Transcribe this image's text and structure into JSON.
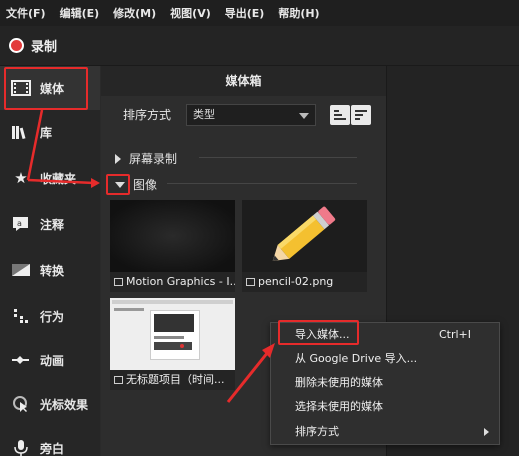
{
  "menubar": {
    "items": [
      "文件(F)",
      "编辑(E)",
      "修改(M)",
      "视图(V)",
      "导出(E)",
      "帮助(H)"
    ]
  },
  "record": {
    "label": "录制",
    "color": "#e33b3b"
  },
  "sidebar": {
    "items": [
      {
        "label": "媒体",
        "icon": "film-icon"
      },
      {
        "label": "库",
        "icon": "library-icon"
      },
      {
        "label": "收藏夹",
        "icon": "star-icon"
      },
      {
        "label": "注释",
        "icon": "annotation-icon"
      },
      {
        "label": "转换",
        "icon": "transition-icon"
      },
      {
        "label": "行为",
        "icon": "behavior-icon"
      },
      {
        "label": "动画",
        "icon": "animation-icon"
      },
      {
        "label": "光标效果",
        "icon": "cursor-icon"
      },
      {
        "label": "旁白",
        "icon": "microphone-icon"
      }
    ]
  },
  "panel": {
    "title": "媒体箱",
    "sort_label": "排序方式",
    "sort_value": "类型",
    "sections": {
      "screen_recording": "屏幕录制",
      "images": "图像"
    },
    "thumbs": [
      {
        "caption": "Motion Graphics - I..."
      },
      {
        "caption": "pencil-02.png"
      },
      {
        "caption": "无标题项目（时间..."
      }
    ]
  },
  "context_menu": {
    "items": [
      {
        "label": "导入媒体...",
        "shortcut": "Ctrl+I"
      },
      {
        "label": "从 Google Drive 导入..."
      },
      {
        "label": "删除未使用的媒体"
      },
      {
        "label": "选择未使用的媒体"
      },
      {
        "label": "排序方式"
      }
    ]
  },
  "colors": {
    "highlight": "#e62b2b",
    "background": "#2a2a2a"
  }
}
